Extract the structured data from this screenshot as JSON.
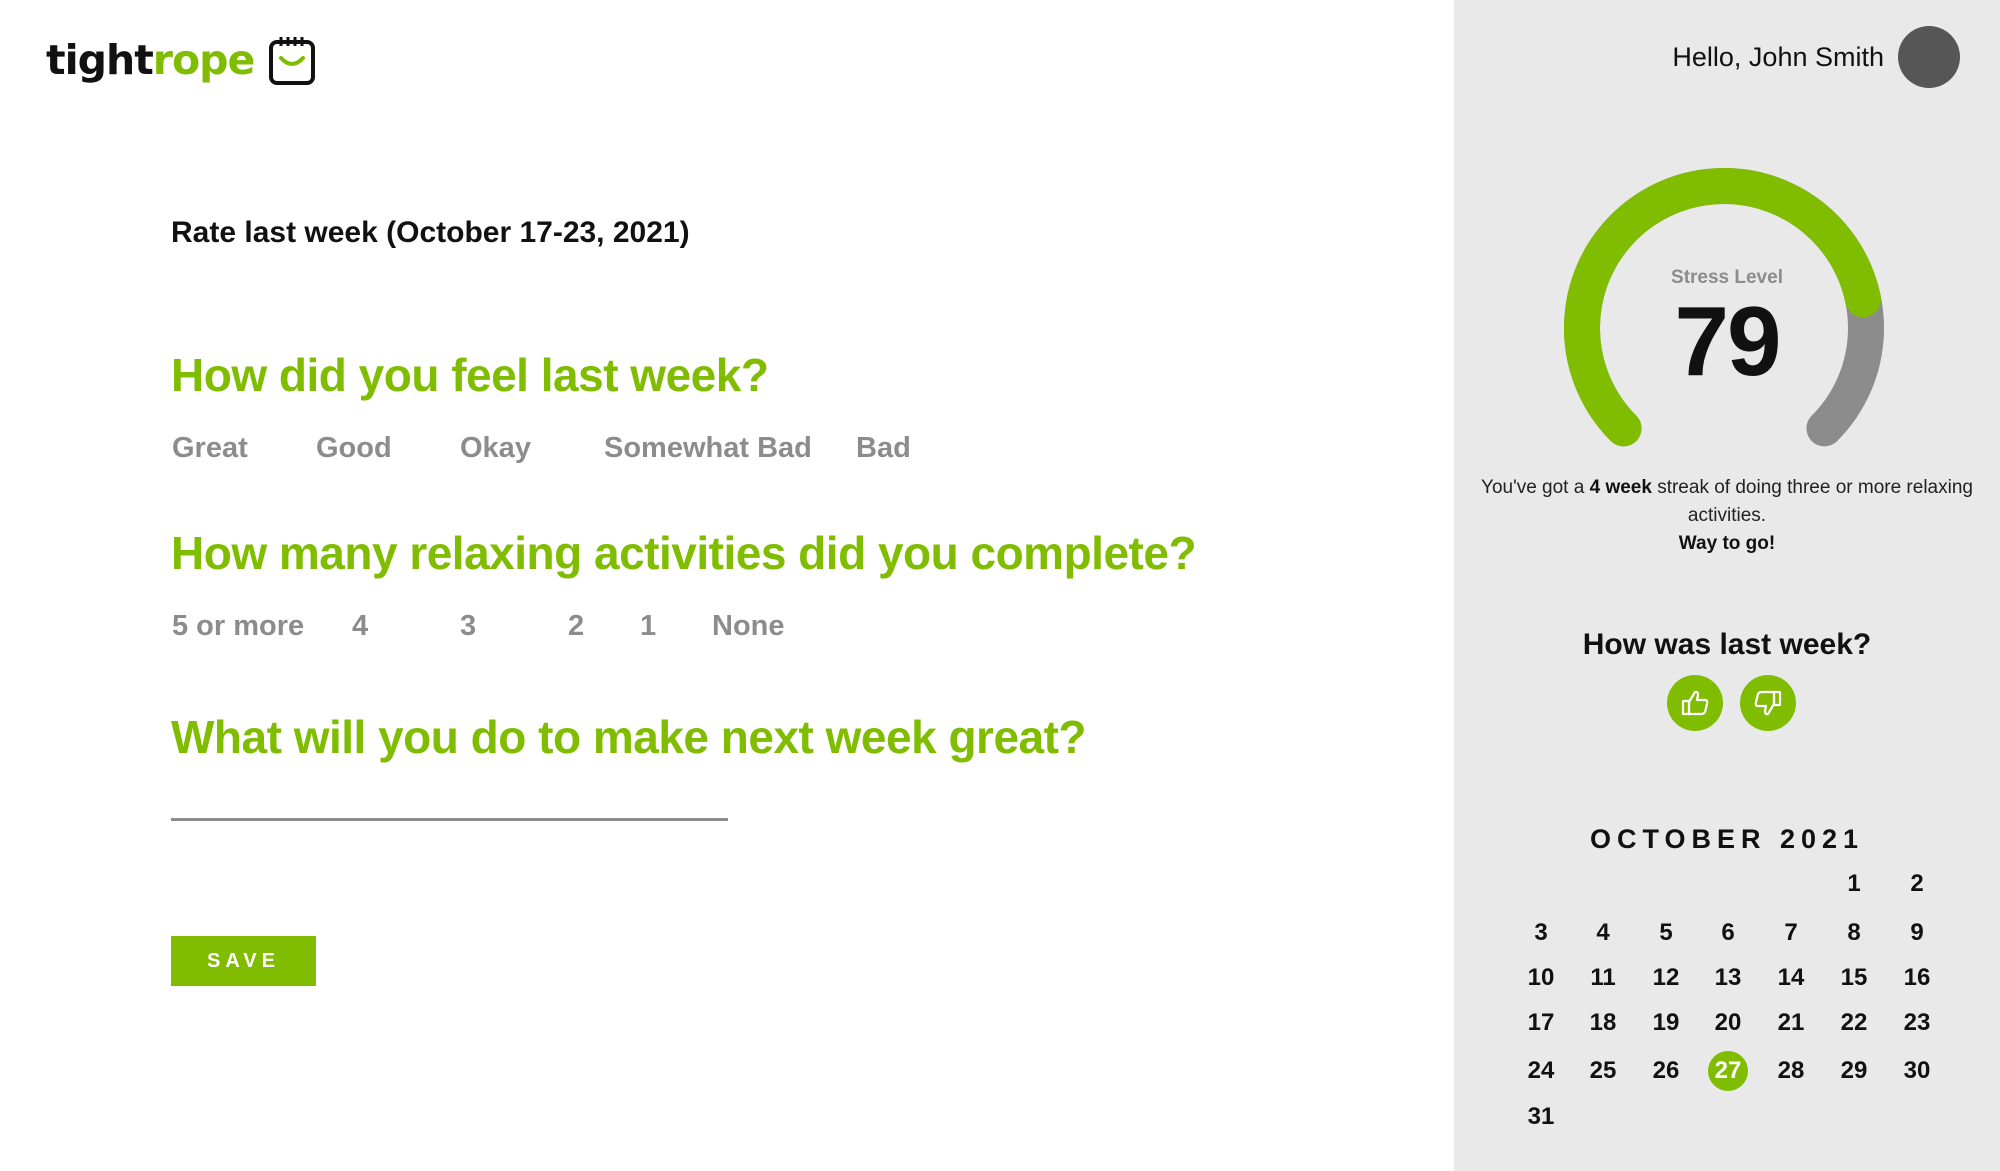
{
  "logo": {
    "part1": "tight",
    "part2": "rope"
  },
  "week_title": "Rate last week (October 17-23, 2021)",
  "q1": {
    "question": "How did you feel last week?",
    "options": [
      "Great",
      "Good",
      "Okay",
      "Somewhat Bad",
      "Bad"
    ]
  },
  "q2": {
    "question": "How many relaxing activities did you complete?",
    "options": [
      "5 or more",
      "4",
      "3",
      "2",
      "1",
      "None"
    ]
  },
  "q3": {
    "question": "What will you do to make next week great?",
    "answer_value": ""
  },
  "save_label": "SAVE",
  "sidebar": {
    "greeting": "Hello, John Smith",
    "stress": {
      "label": "Stress Level",
      "value": "79",
      "fraction": 0.79
    },
    "streak": {
      "pre": "You've got a ",
      "bold": "4 week",
      "post": " streak of doing three or more relaxing activities.",
      "cheer": "Way to go!"
    },
    "how_title": "How was last week?",
    "calendar": {
      "title": "OCTOBER 2021",
      "first_weekday": 5,
      "days_in_month": 31,
      "today": 27
    }
  },
  "colors": {
    "accent": "#80bc00",
    "muted": "#8c8c8c",
    "sidebar_bg": "#e9e9e9",
    "avatar": "#565656"
  },
  "icons": {
    "thumb_up": "thumbs-up-icon",
    "thumb_down": "thumbs-down-icon",
    "logo": "calendar-smile-icon"
  }
}
